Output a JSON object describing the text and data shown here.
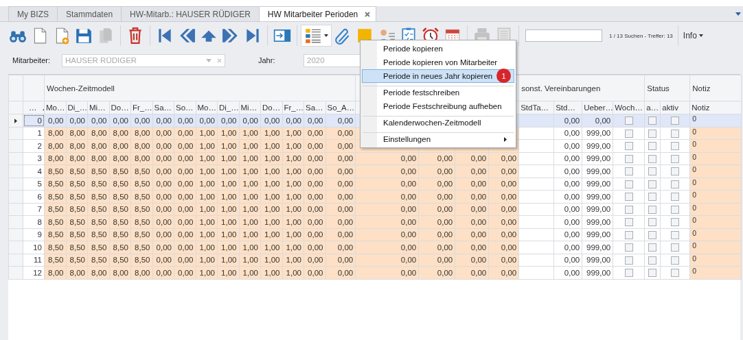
{
  "tabs": [
    {
      "label": "My BIZS",
      "selected": false,
      "closable": false
    },
    {
      "label": "Stammdaten",
      "selected": false,
      "closable": false
    },
    {
      "label": "HW-Mitarb.: HAUSER RÜDIGER",
      "selected": false,
      "closable": false
    },
    {
      "label": "HW Mitarbeiter Perioden",
      "selected": true,
      "closable": true
    }
  ],
  "toolbar": {
    "groups": [
      [
        {
          "kind": "find",
          "disabled": false
        },
        {
          "kind": "new",
          "disabled": false
        },
        {
          "kind": "new-from",
          "disabled": false
        },
        {
          "kind": "save",
          "disabled": false
        },
        {
          "kind": "duplicate",
          "disabled": true
        }
      ],
      [
        {
          "kind": "delete",
          "disabled": false
        }
      ],
      [
        {
          "kind": "first",
          "disabled": false
        },
        {
          "kind": "previous",
          "disabled": false
        },
        {
          "kind": "up",
          "disabled": false
        },
        {
          "kind": "next",
          "disabled": false
        },
        {
          "kind": "last",
          "disabled": false
        }
      ],
      [
        {
          "kind": "export",
          "disabled": false
        }
      ],
      [
        {
          "kind": "actions",
          "disabled": false
        },
        {
          "kind": "attach",
          "disabled": false
        },
        {
          "kind": "note",
          "disabled": false
        },
        {
          "kind": "contacts",
          "disabled": false
        },
        {
          "kind": "tasks",
          "disabled": false
        },
        {
          "kind": "reminder",
          "disabled": false
        },
        {
          "kind": "calendar",
          "disabled": false
        }
      ],
      [
        {
          "kind": "print",
          "disabled": true
        },
        {
          "kind": "preview",
          "disabled": true
        }
      ]
    ],
    "search_status": "1 / 13 Suchen - Treffer: 13",
    "info": "Info"
  },
  "filters": {
    "employee": {
      "label": "Mitarbeiter:",
      "value": "HAUSER RÜDIGER",
      "disabled": true
    },
    "year": {
      "label": "Jahr:",
      "value": "2020"
    }
  },
  "grid": {
    "number_column": {
      "label": "…",
      "sort_ascending": true
    },
    "groups": [
      {
        "label": "Wochen-Zeitmodell",
        "columns": [
          {
            "label": "Mo…",
            "kind": "number",
            "shaded": true
          },
          {
            "label": "Di_…",
            "kind": "number",
            "shaded": true
          },
          {
            "label": "Mi…",
            "kind": "number",
            "shaded": true
          },
          {
            "label": "Do…",
            "kind": "number",
            "shaded": true
          },
          {
            "label": "Fr_…",
            "kind": "number",
            "shaded": true
          },
          {
            "label": "Sa…",
            "kind": "number",
            "shaded": true
          },
          {
            "label": "So…",
            "kind": "number",
            "shaded": true
          },
          {
            "label": "Mo…",
            "kind": "number",
            "shaded": true
          },
          {
            "label": "Di_…",
            "kind": "number",
            "shaded": true
          },
          {
            "label": "Mi…",
            "kind": "number",
            "shaded": true
          },
          {
            "label": "Do…",
            "kind": "number",
            "shaded": true
          },
          {
            "label": "Fr_…",
            "kind": "number",
            "shaded": true
          },
          {
            "label": "Sa…",
            "kind": "number",
            "shaded": true
          },
          {
            "label": "So_A…",
            "kind": "number",
            "shaded": true
          }
        ]
      },
      {
        "columns": [
          {
            "kind": "number",
            "shaded": true
          },
          {
            "kind": "number",
            "shaded": true
          },
          {
            "kind": "number",
            "shaded": true
          },
          {
            "kind": "number",
            "shaded": true
          }
        ]
      },
      {
        "label": "sonst. Vereinbarungen",
        "columns": [
          {
            "label": "StdTa…",
            "kind": "number",
            "shaded": false
          },
          {
            "label": "Std…",
            "kind": "number",
            "shaded": false
          },
          {
            "label": "Ueber…",
            "kind": "number",
            "shaded": false
          },
          {
            "label": "Woch…",
            "kind": "check",
            "shaded": false
          }
        ]
      },
      {
        "label": "Status",
        "columns": [
          {
            "label": "a…",
            "kind": "check",
            "shaded": false
          },
          {
            "label": "aktiv",
            "kind": "check",
            "shaded": false
          }
        ]
      },
      {
        "label": "Notiz",
        "columns": [
          {
            "label": "Notiz",
            "kind": "text",
            "shaded": true
          }
        ]
      }
    ],
    "rows": [
      {
        "number": "0",
        "selected": true,
        "current": true,
        "cells": [
          "0,00",
          "0,00",
          "0,00",
          "0,00",
          "0,00",
          "0,00",
          "0,00",
          "0,00",
          "0,00",
          "0,00",
          "0,00",
          "0,00",
          "0,00",
          "0,00",
          null,
          null,
          null,
          null,
          null,
          "0,00",
          "0,00",
          false,
          false,
          false,
          "0"
        ]
      },
      {
        "number": "1",
        "selected": false,
        "current": false,
        "cells": [
          "8,00",
          "8,00",
          "8,00",
          "8,00",
          "8,00",
          "0,00",
          "0,00",
          "1,00",
          "1,00",
          "1,00",
          "1,00",
          "1,00",
          "0,00",
          "0,00",
          null,
          null,
          null,
          null,
          null,
          "0,00",
          "999,00",
          false,
          false,
          false,
          "0"
        ]
      },
      {
        "number": "2",
        "selected": false,
        "current": false,
        "cells": [
          "8,00",
          "8,00",
          "8,00",
          "8,00",
          "8,00",
          "0,00",
          "0,00",
          "1,00",
          "1,00",
          "1,00",
          "1,00",
          "1,00",
          "0,00",
          "0,00",
          null,
          null,
          null,
          null,
          null,
          "0,00",
          "999,00",
          false,
          false,
          false,
          "0"
        ]
      },
      {
        "number": "3",
        "selected": false,
        "current": false,
        "cells": [
          "8,00",
          "8,00",
          "8,00",
          "8,00",
          "8,00",
          "0,00",
          "0,00",
          "1,00",
          "1,00",
          "1,00",
          "1,00",
          "1,00",
          "0,00",
          "0,00",
          "0,00",
          "0,00",
          "0,00",
          "0,00",
          null,
          "0,00",
          "999,00",
          false,
          false,
          false,
          "0"
        ]
      },
      {
        "number": "4",
        "selected": false,
        "current": false,
        "cells": [
          "8,50",
          "8,50",
          "8,50",
          "8,50",
          "8,50",
          "0,00",
          "0,00",
          "1,00",
          "1,00",
          "1,00",
          "1,00",
          "1,00",
          "0,00",
          "0,00",
          "0,00",
          "0,00",
          "0,00",
          "0,00",
          null,
          "0,00",
          "999,00",
          false,
          false,
          false,
          "0"
        ]
      },
      {
        "number": "5",
        "selected": false,
        "current": false,
        "cells": [
          "8,50",
          "8,50",
          "8,50",
          "8,50",
          "8,50",
          "0,00",
          "0,00",
          "1,00",
          "1,00",
          "1,00",
          "1,00",
          "1,00",
          "0,00",
          "0,00",
          "0,00",
          "0,00",
          "0,00",
          "0,00",
          null,
          "0,00",
          "999,00",
          false,
          false,
          false,
          "0"
        ]
      },
      {
        "number": "6",
        "selected": false,
        "current": false,
        "cells": [
          "8,50",
          "8,50",
          "8,50",
          "8,50",
          "8,50",
          "0,00",
          "0,00",
          "1,00",
          "1,00",
          "1,00",
          "1,00",
          "1,00",
          "0,00",
          "0,00",
          "0,00",
          "0,00",
          "0,00",
          "0,00",
          null,
          "0,00",
          "999,00",
          false,
          false,
          false,
          "0"
        ]
      },
      {
        "number": "7",
        "selected": false,
        "current": false,
        "cells": [
          "8,50",
          "8,50",
          "8,50",
          "8,50",
          "8,50",
          "0,00",
          "0,00",
          "1,00",
          "1,00",
          "1,00",
          "1,00",
          "1,00",
          "0,00",
          "0,00",
          "0,00",
          "0,00",
          "0,00",
          "0,00",
          null,
          "0,00",
          "999,00",
          false,
          false,
          false,
          "0"
        ]
      },
      {
        "number": "8",
        "selected": false,
        "current": false,
        "cells": [
          "8,50",
          "8,50",
          "8,50",
          "8,50",
          "8,50",
          "0,00",
          "0,00",
          "1,00",
          "1,00",
          "1,00",
          "1,00",
          "1,00",
          "0,00",
          "0,00",
          "0,00",
          "0,00",
          "0,00",
          "0,00",
          null,
          "0,00",
          "999,00",
          false,
          false,
          false,
          "0"
        ]
      },
      {
        "number": "9",
        "selected": false,
        "current": false,
        "cells": [
          "8,50",
          "8,50",
          "8,50",
          "8,50",
          "8,50",
          "0,00",
          "0,00",
          "1,00",
          "1,00",
          "1,00",
          "1,00",
          "1,00",
          "0,00",
          "0,00",
          "0,00",
          "0,00",
          "0,00",
          "0,00",
          null,
          "0,00",
          "999,00",
          false,
          false,
          false,
          "0"
        ]
      },
      {
        "number": "10",
        "selected": false,
        "current": false,
        "cells": [
          "8,50",
          "8,50",
          "8,50",
          "8,50",
          "8,50",
          "0,00",
          "0,00",
          "1,00",
          "1,00",
          "1,00",
          "1,00",
          "1,00",
          "0,00",
          "0,00",
          "0,00",
          "0,00",
          "0,00",
          "0,00",
          null,
          "0,00",
          "999,00",
          false,
          false,
          false,
          "0"
        ]
      },
      {
        "number": "11",
        "selected": false,
        "current": false,
        "cells": [
          "8,50",
          "8,50",
          "8,50",
          "8,50",
          "8,50",
          "0,00",
          "0,00",
          "1,00",
          "1,00",
          "1,00",
          "1,00",
          "1,00",
          "0,00",
          "0,00",
          "0,00",
          "0,00",
          "0,00",
          "0,00",
          null,
          "0,00",
          "999,00",
          false,
          false,
          false,
          "0"
        ]
      },
      {
        "number": "12",
        "selected": false,
        "current": false,
        "cells": [
          "8,00",
          "8,00",
          "8,00",
          "8,00",
          "8,00",
          "0,00",
          "0,00",
          "1,00",
          "1,00",
          "1,00",
          "1,00",
          "1,00",
          "0,00",
          "0,00",
          "0,00",
          "0,00",
          "0,00",
          "0,00",
          null,
          "0,00",
          "999,00",
          false,
          false,
          false,
          "0"
        ]
      }
    ]
  },
  "context_menu": {
    "items": [
      {
        "label": "Periode kopieren",
        "selected": false,
        "separator_before": false,
        "submenu": false
      },
      {
        "label": "Periode kopieren von Mitarbeiter",
        "selected": false,
        "separator_before": false,
        "submenu": false
      },
      {
        "label": "Periode in neues Jahr kopieren",
        "selected": true,
        "separator_before": false,
        "submenu": false,
        "badge": "1"
      },
      {
        "label": "Periode festschreiben",
        "selected": false,
        "separator_before": true,
        "submenu": false
      },
      {
        "label": "Periode Festschreibung aufheben",
        "selected": false,
        "separator_before": false,
        "submenu": false
      },
      {
        "label": "Kalenderwochen-Zeitmodell",
        "selected": false,
        "separator_before": true,
        "submenu": false
      },
      {
        "label": "Einstellungen",
        "selected": false,
        "separator_before": true,
        "submenu": true
      }
    ]
  }
}
